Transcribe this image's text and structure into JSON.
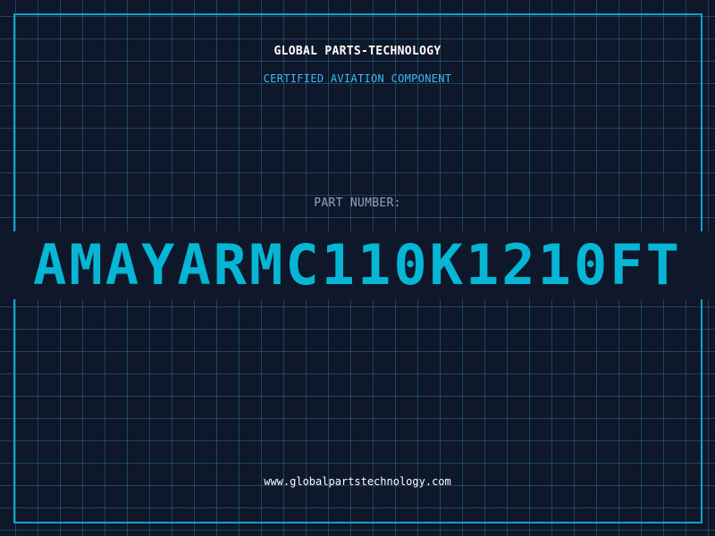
{
  "header": {
    "brand": "GLOBAL PARTS-TECHNOLOGY",
    "subtitle": "CERTIFIED AVIATION COMPONENT"
  },
  "part": {
    "label": "PART NUMBER:",
    "number": "AMAYARMC110K1210FT"
  },
  "footer": {
    "website": "www.globalpartstechnology.com"
  },
  "colors": {
    "background": "#0f172a",
    "grid": "#1e4a63",
    "frame": "#0ea5c6",
    "accent": "#06b6d4",
    "subtitle": "#38bdf8",
    "label": "#94a3b8",
    "text": "#ffffff"
  }
}
